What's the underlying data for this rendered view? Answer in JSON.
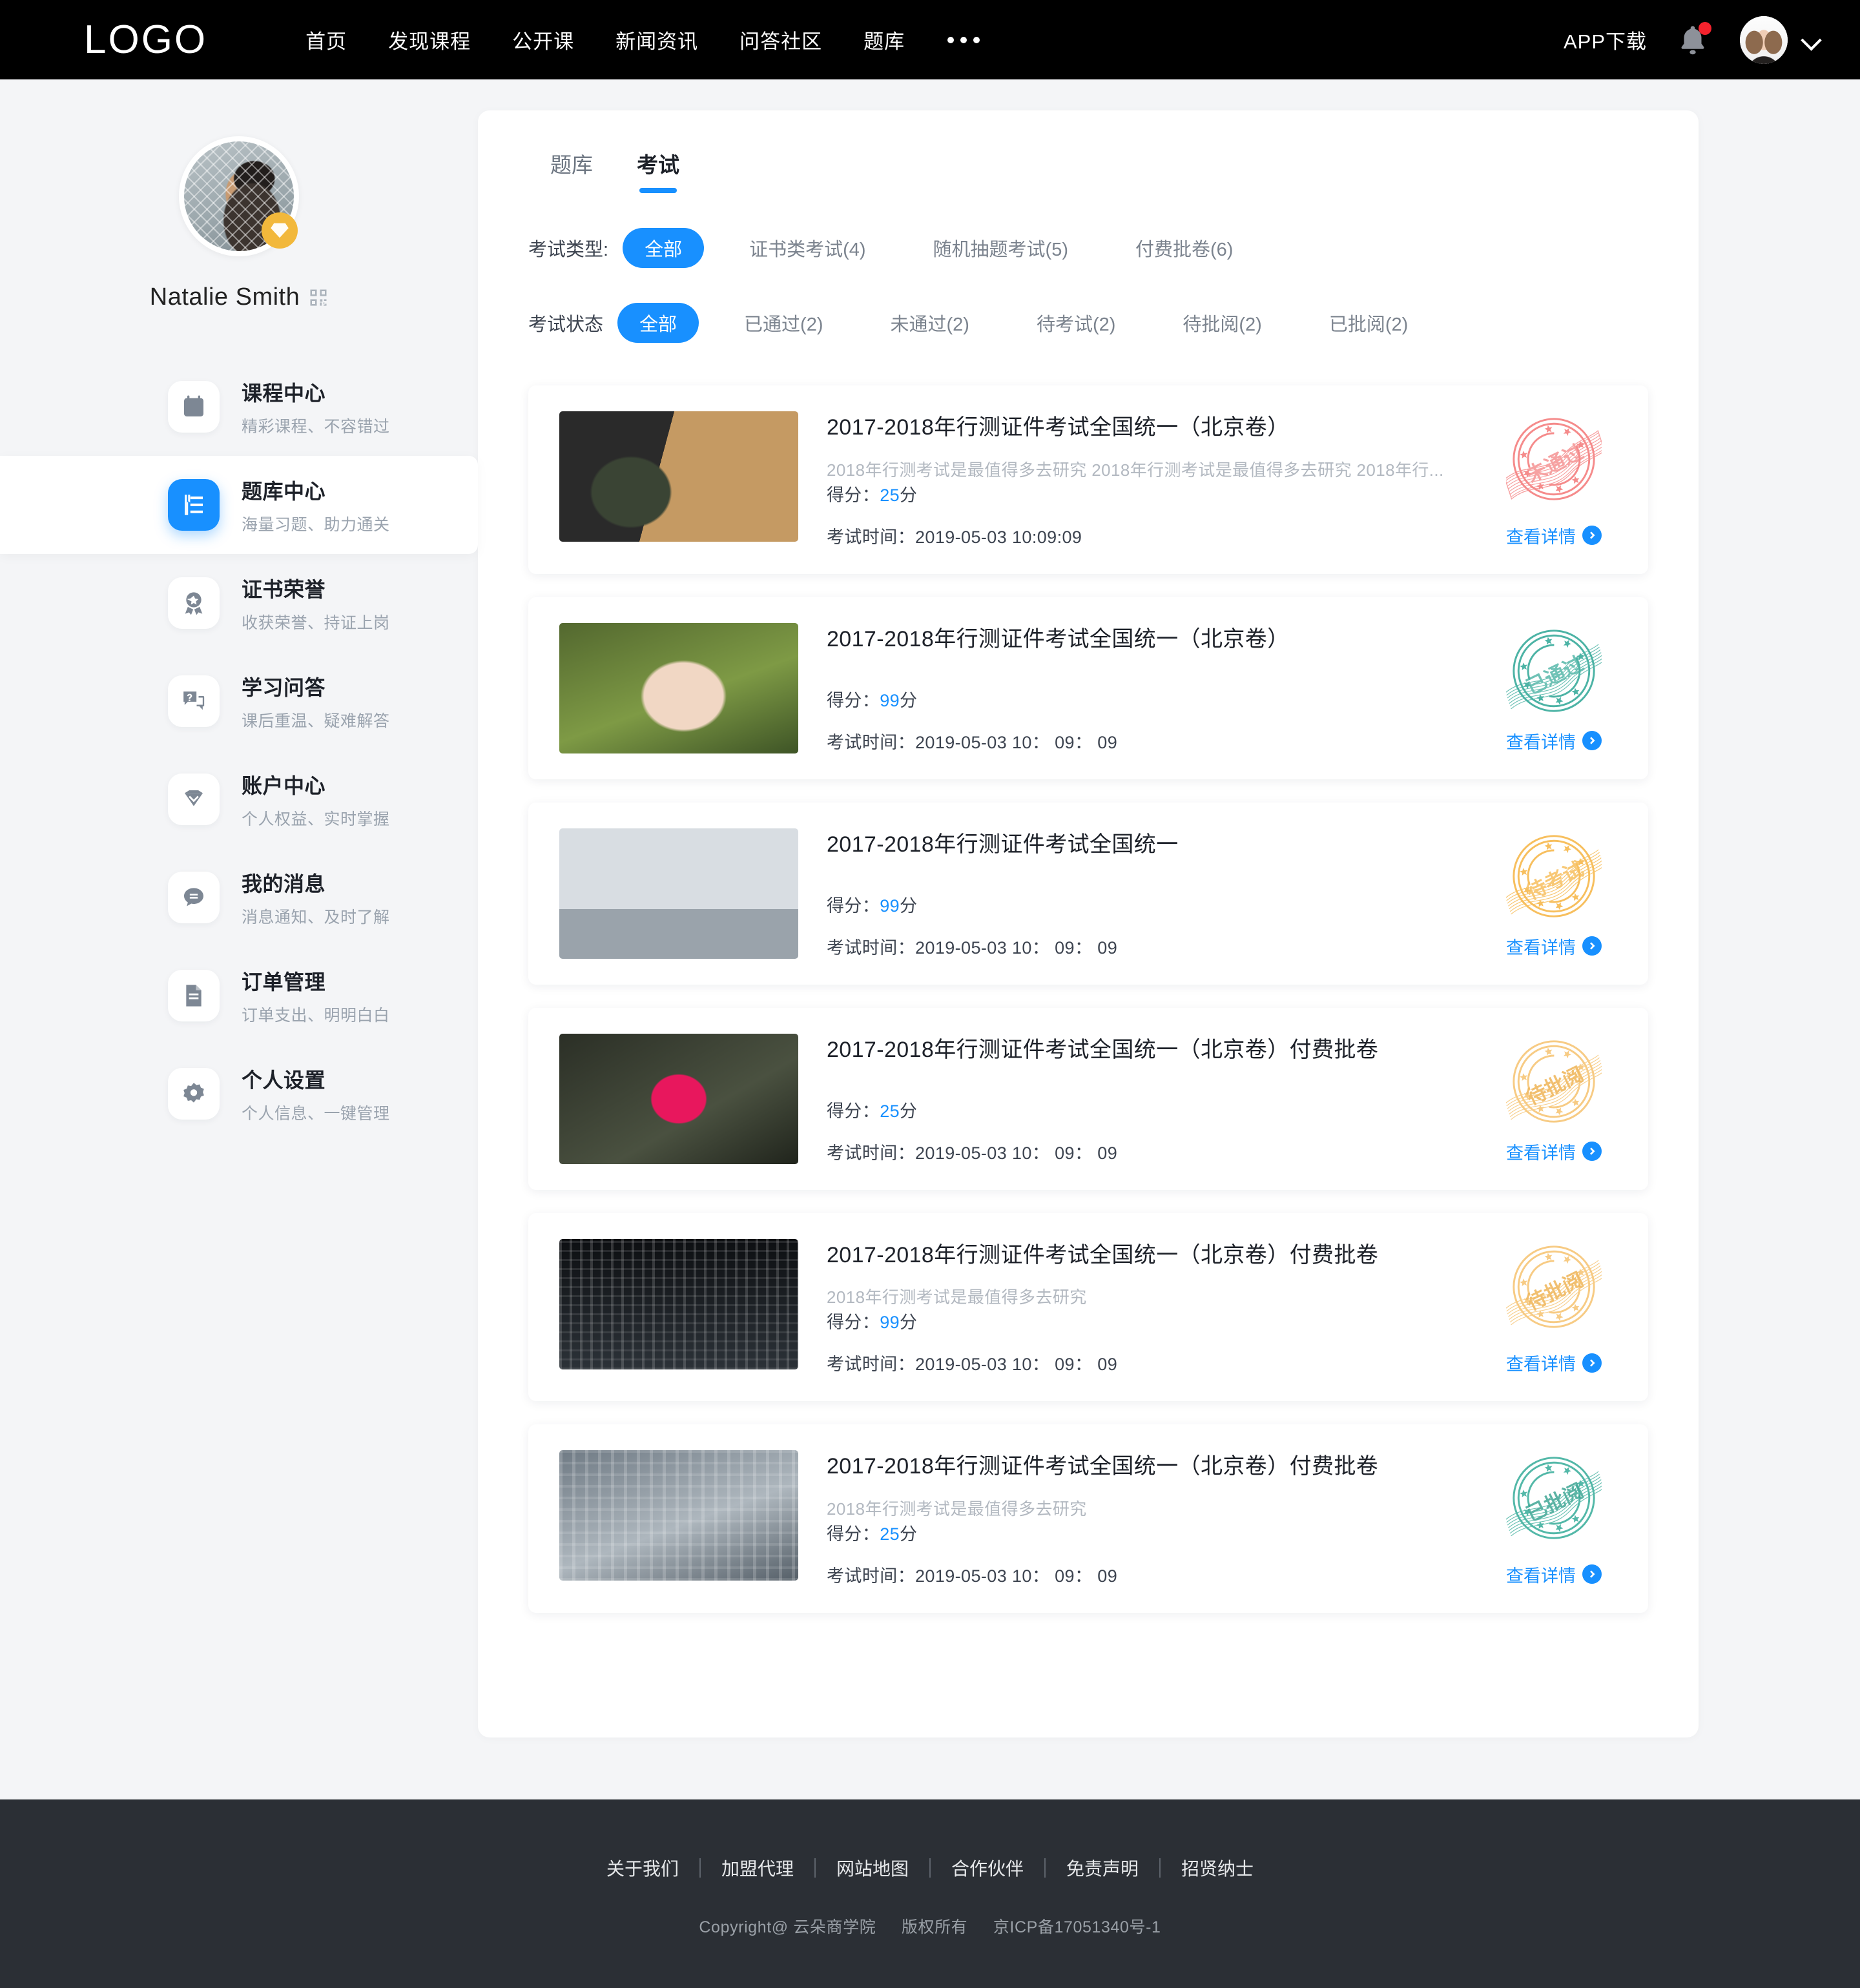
{
  "header": {
    "logo": "LOGO",
    "nav": [
      "首页",
      "发现课程",
      "公开课",
      "新闻资讯",
      "问答社区",
      "题库"
    ],
    "more_icon": "ellipsis-icon",
    "app_download": "APP下载",
    "bell_icon": "bell-icon",
    "avatar_icon": "user-avatar",
    "chevron_icon": "chevron-down-icon",
    "accent": "#1890ff"
  },
  "sidebar": {
    "user_name": "Natalie Smith",
    "qr_icon": "qr-code-icon",
    "vip_icon": "diamond-badge-icon",
    "items": [
      {
        "title": "课程中心",
        "sub": "精彩课程、不容错过",
        "icon": "calendar-icon",
        "active": false
      },
      {
        "title": "题库中心",
        "sub": "海量习题、助力通关",
        "icon": "book-icon",
        "active": true
      },
      {
        "title": "证书荣誉",
        "sub": "收获荣誉、持证上岗",
        "icon": "medal-icon",
        "active": false
      },
      {
        "title": "学习问答",
        "sub": "课后重温、疑难解答",
        "icon": "chat-question-icon",
        "active": false
      },
      {
        "title": "账户中心",
        "sub": "个人权益、实时掌握",
        "icon": "diamond-icon",
        "active": false
      },
      {
        "title": "我的消息",
        "sub": "消息通知、及时了解",
        "icon": "message-icon",
        "active": false
      },
      {
        "title": "订单管理",
        "sub": "订单支出、明明白白",
        "icon": "document-icon",
        "active": false
      },
      {
        "title": "个人设置",
        "sub": "个人信息、一键管理",
        "icon": "gear-icon",
        "active": false
      }
    ]
  },
  "main": {
    "tabs": [
      {
        "label": "题库",
        "active": false
      },
      {
        "label": "考试",
        "active": true
      }
    ],
    "filters": [
      {
        "label": "考试类型:",
        "options": [
          {
            "label": "全部",
            "selected": true
          },
          {
            "label": "证书类考试(4)",
            "selected": false
          },
          {
            "label": "随机抽题考试(5)",
            "selected": false
          },
          {
            "label": "付费批卷(6)",
            "selected": false
          }
        ]
      },
      {
        "label": "考试状态",
        "options": [
          {
            "label": "全部",
            "selected": true
          },
          {
            "label": "已通过(2)",
            "selected": false
          },
          {
            "label": "未通过(2)",
            "selected": false
          },
          {
            "label": "待考试(2)",
            "selected": false
          },
          {
            "label": "待批阅(2)",
            "selected": false
          },
          {
            "label": "已批阅(2)",
            "selected": false
          }
        ]
      }
    ],
    "score_label": "得分：",
    "score_unit": "分",
    "time_label": "考试时间：",
    "detail_label": "查看详情",
    "cards": [
      {
        "title": "2017-2018年行测证件考试全国统一（北京卷）",
        "desc": "2018年行测考试是最值得多去研究 2018年行测考试是最值得多去研究 2018年行...",
        "score": "25",
        "time": "2019-05-03  10:09:09",
        "stamp_text": "未通过",
        "stamp_color": "#f58b8b",
        "thumb": "t1"
      },
      {
        "title": "2017-2018年行测证件考试全国统一（北京卷）",
        "desc": "",
        "score": "99",
        "time": "2019-05-03  10： 09： 09",
        "stamp_text": "已通过",
        "stamp_color": "#4cb3a5",
        "thumb": "t2"
      },
      {
        "title": "2017-2018年行测证件考试全国统一",
        "desc": "",
        "score": "99",
        "time": "2019-05-03  10： 09： 09",
        "stamp_text": "待考试",
        "stamp_color": "#f7bf5e",
        "thumb": "t3"
      },
      {
        "title": "2017-2018年行测证件考试全国统一（北京卷）付费批卷",
        "desc": "",
        "score": "25",
        "time": "2019-05-03  10： 09： 09",
        "stamp_text": "待批阅",
        "stamp_color": "#f7cb84",
        "thumb": "t4"
      },
      {
        "title": "2017-2018年行测证件考试全国统一（北京卷）付费批卷",
        "desc": "2018年行测考试是最值得多去研究",
        "score": "99",
        "time": "2019-05-03  10： 09： 09",
        "stamp_text": "待批阅",
        "stamp_color": "#f7cb84",
        "thumb": "t5"
      },
      {
        "title": "2017-2018年行测证件考试全国统一（北京卷）付费批卷",
        "desc": "2018年行测考试是最值得多去研究",
        "score": "25",
        "time": "2019-05-03  10： 09： 09",
        "stamp_text": "已批阅",
        "stamp_color": "#53b8a8",
        "thumb": "t6"
      }
    ]
  },
  "footer": {
    "links": [
      "关于我们",
      "加盟代理",
      "网站地图",
      "合作伙伴",
      "免责声明",
      "招贤纳士"
    ],
    "copyright": "Copyright@ 云朵商学院",
    "rights": "版权所有",
    "icp": "京ICP备17051340号-1"
  }
}
